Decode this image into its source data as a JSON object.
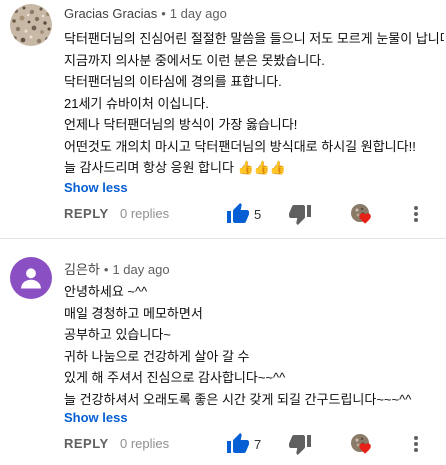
{
  "comments": [
    {
      "author": "Gracias Gracias",
      "time": "1 day ago",
      "avatar_icon": "speckled-photo-avatar",
      "lines": [
        "닥터팬더님의  진심어린 절절한 말씀을 들으니 저도 모르게 눈물이 납니다..",
        "지금까지 의사분 중에서도 이런 분은 못봤습니다.",
        "닥터팬더님의 이타심에 경의를 표합니다.",
        "21세기 슈바이처 이십니다.",
        "언제나 닥터팬더님의 방식이 가장 옳습니다!",
        "어떤것도 개의치 마시고 닥터팬더님의 방식대로 하시길 원합니다!!",
        "늘 감사드리며 항상 응원 합니다 👍👍👍"
      ],
      "show_less": "Show less",
      "reply_label": "REPLY",
      "replies_label": "0 replies",
      "like_count": "5"
    },
    {
      "author": "김은하",
      "time": "1 day ago",
      "avatar_icon": "purple-person-avatar",
      "lines": [
        "안녕하세요 ~^^",
        "매일 경청하고 메모하면서",
        "공부하고 있습니다~",
        "귀하 나눔으로 건강하게 살아 갈 수",
        "있게 해 주셔서 진심으로 감사합니다~~^^",
        "늘 건강하셔서 오래도록 좋은 시간 갖게 되길 간구드립니다~~~^^"
      ],
      "show_less": "Show less",
      "reply_label": "REPLY",
      "replies_label": "0 replies",
      "like_count": "7"
    }
  ],
  "colors": {
    "link_blue": "#065fd4",
    "like_blue": "#065fd4",
    "heart_red": "#e62117",
    "avatar_purple": "#8b4fc4"
  }
}
